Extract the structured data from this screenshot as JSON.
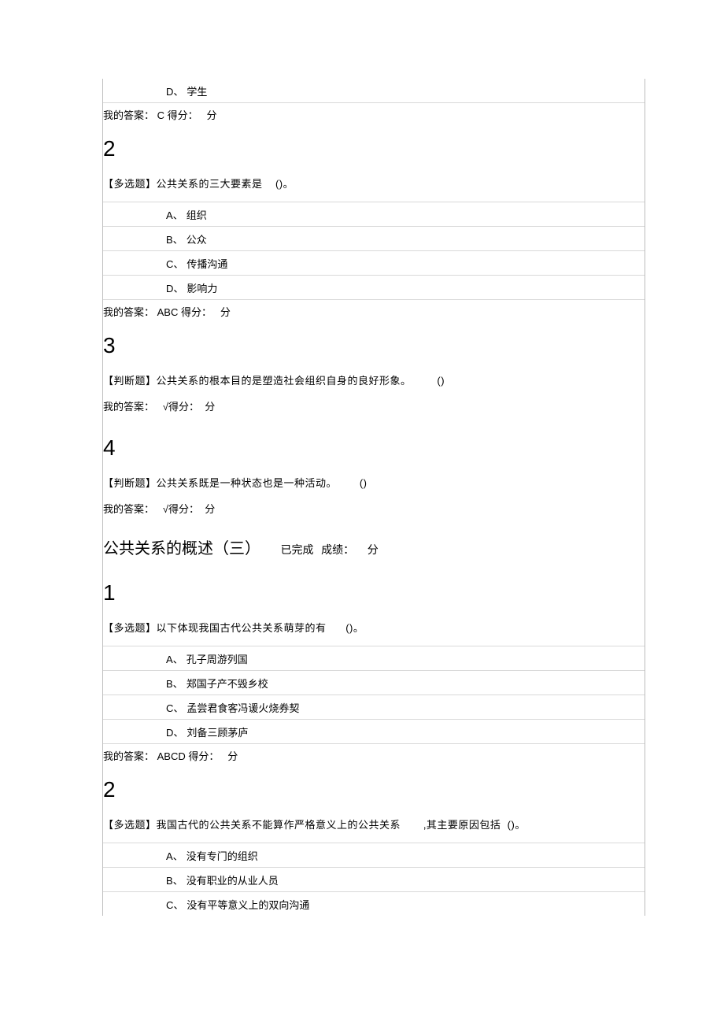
{
  "top": {
    "q1_remnant_option": {
      "letter": "D",
      "punc": "、",
      "text": "学生"
    },
    "q1_answer": {
      "label": "我的答案：",
      "value": "C",
      "score_label": "得分：",
      "score_unit": "分"
    },
    "q2_num": "2",
    "q2_stem_prefix": "【多选题】公共关系的三大要素是",
    "q2_stem_paren": "()。",
    "q2_options": [
      {
        "letter": "A",
        "punc": "、",
        "text": "组织"
      },
      {
        "letter": "B",
        "punc": "、",
        "text": "公众"
      },
      {
        "letter": "C",
        "punc": "、",
        "text": "传播沟通"
      },
      {
        "letter": "D",
        "punc": "、",
        "text": "影响力"
      }
    ],
    "q2_answer": {
      "label": "我的答案：",
      "value": "ABC",
      "score_label": "得分：",
      "score_unit": "分"
    },
    "q3_num": "3",
    "q3_stem_prefix": "【判断题】公共关系的根本目的是塑造社会组织自身的良好形象。",
    "q3_stem_paren": "()",
    "q3_answer": {
      "label": "我的答案：",
      "value": "√",
      "score_label": "得分：",
      "score_unit": "分"
    },
    "q4_num": "4",
    "q4_stem_prefix": "【判断题】公共关系既是一种状态也是一种活动。",
    "q4_stem_paren": "()",
    "q4_answer": {
      "label": "我的答案：",
      "value": "√",
      "score_label": "得分：",
      "score_unit": "分"
    }
  },
  "section3": {
    "title": "公共关系的概述（三）",
    "status": "已完成",
    "score_label": "成绩：",
    "score_unit": "分",
    "q1_num": "1",
    "q1_stem_prefix": "【多选题】以下体现我国古代公共关系萌芽的有",
    "q1_stem_paren": "()。",
    "q1_options": [
      {
        "letter": "A",
        "punc": "、",
        "text": "孔子周游列国"
      },
      {
        "letter": "B",
        "punc": "、",
        "text": "郑国子产不毁乡校"
      },
      {
        "letter": "C",
        "punc": "、",
        "text": "孟尝君食客冯谖火烧券契"
      },
      {
        "letter": "D",
        "punc": "、",
        "text": "刘备三顾茅庐"
      }
    ],
    "q1_answer": {
      "label": "我的答案：",
      "value": "ABCD",
      "score_label": "得分：",
      "score_unit": "分"
    },
    "q2_num": "2",
    "q2_stem_prefix": "【多选题】我国古代的公共关系不能算作严格意义上的公共关系",
    "q2_stem_mid": ",其主要原因包括",
    "q2_stem_paren": "()。",
    "q2_options": [
      {
        "letter": "A",
        "punc": "、",
        "text": "没有专门的组织"
      },
      {
        "letter": "B",
        "punc": "、",
        "text": "没有职业的从业人员"
      },
      {
        "letter": "C",
        "punc": "、",
        "text": "没有平等意义上的双向沟通"
      }
    ]
  }
}
